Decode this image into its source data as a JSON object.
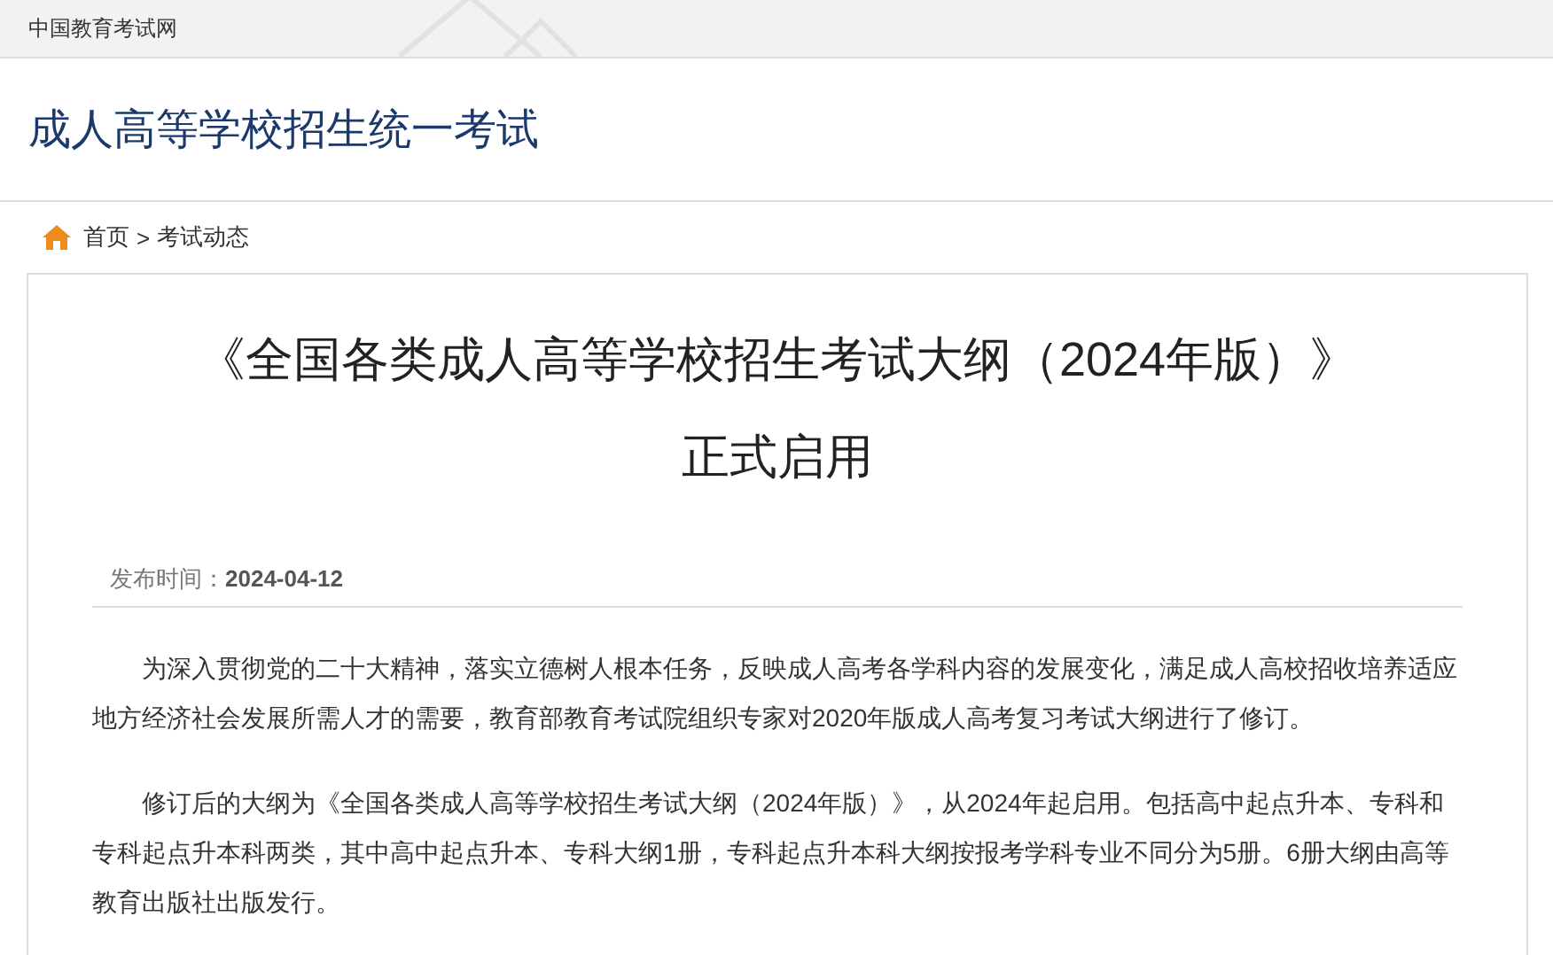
{
  "top_bar": {
    "site_name": "中国教育考试网"
  },
  "header": {
    "title": "成人高等学校招生统一考试"
  },
  "breadcrumb": [
    {
      "label": "首页"
    },
    {
      "label": "考试动态"
    }
  ],
  "breadcrumb_separator": ">",
  "article": {
    "title_lines": [
      "《全国各类成人高等学校招生考试大纲（2024年版）》",
      "正式启用"
    ],
    "meta_label": "发布时间：",
    "date": "2024-04-12",
    "paragraphs": [
      "为深入贯彻党的二十大精神，落实立德树人根本任务，反映成人高考各学科内容的发展变化，满足成人高校招收培养适应地方经济社会发展所需人才的需要，教育部教育考试院组织专家对2020年版成人高考复习考试大纲进行了修订。",
      "修订后的大纲为《全国各类成人高等学校招生考试大纲（2024年版）》，从2024年起启用。包括高中起点升本、专科和专科起点升本科两类，其中高中起点升本、专科大纲1册，专科起点升本科大纲按报考学科专业不同分为5册。6册大纲由高等教育出版社出版发行。"
    ]
  }
}
